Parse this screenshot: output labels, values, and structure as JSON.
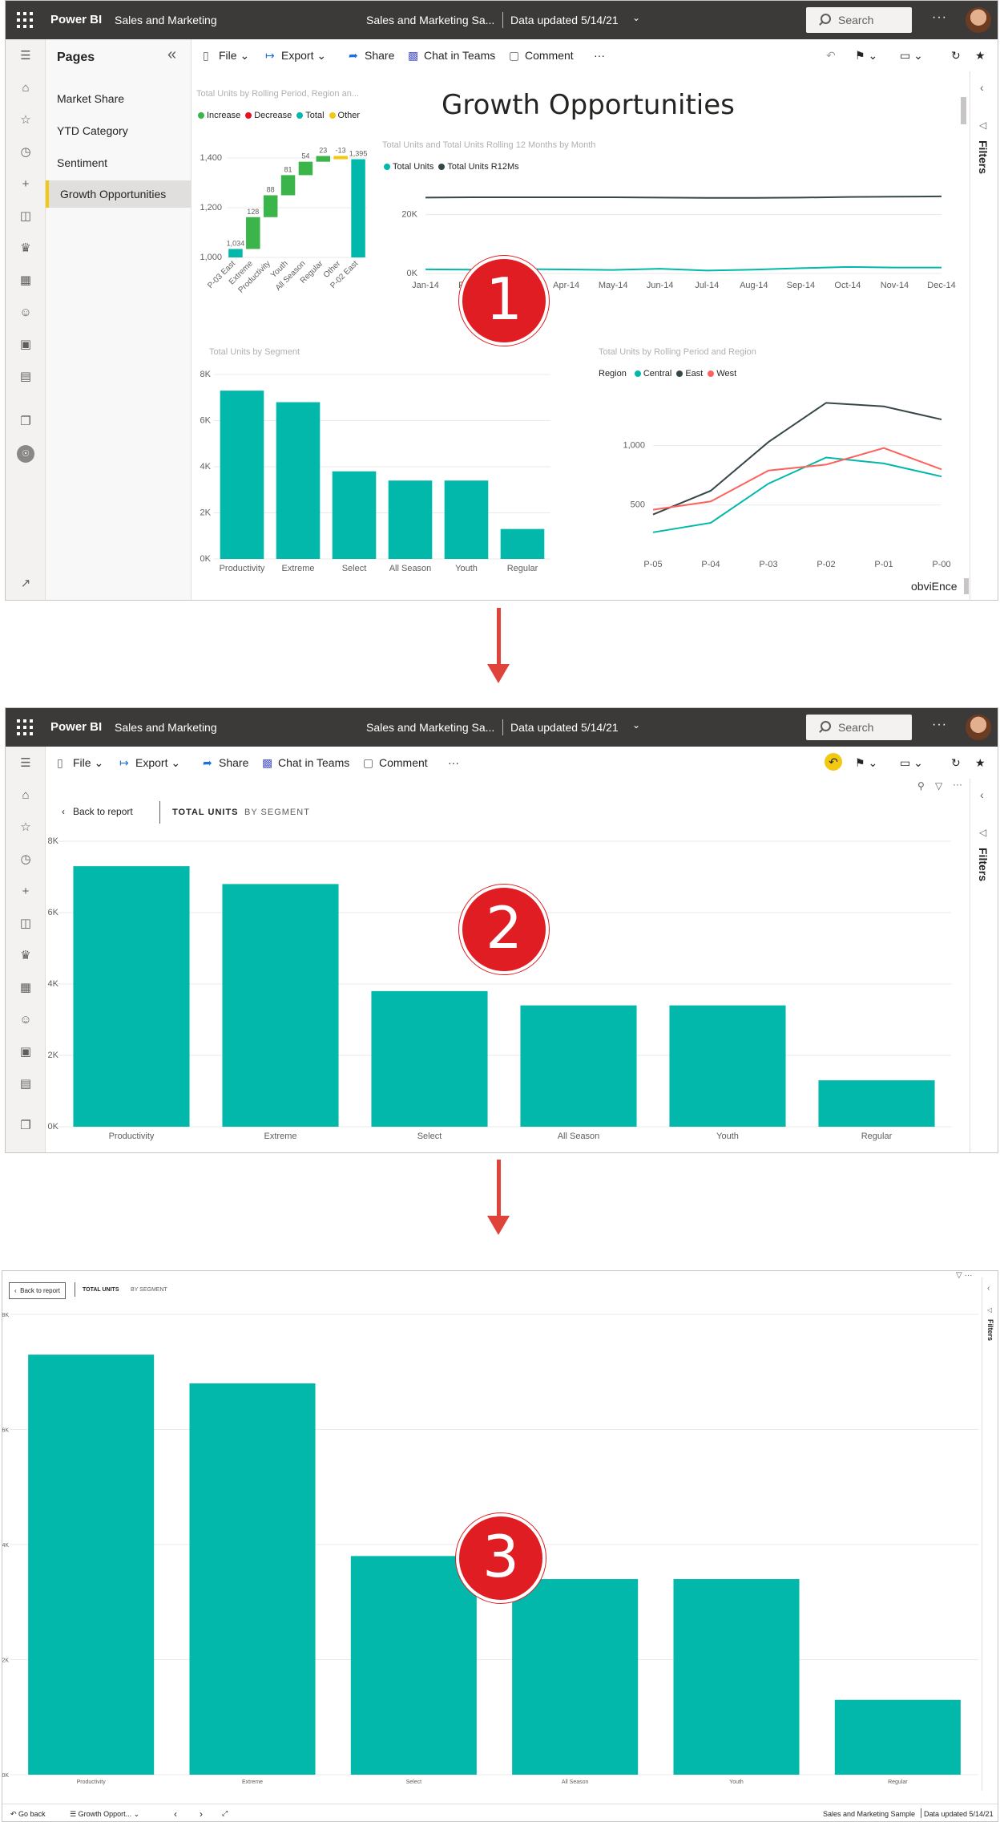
{
  "header": {
    "brand": "Power BI",
    "workspace": "Sales and Marketing",
    "report_title": "Sales and Marketing Sa...",
    "data_updated": "Data updated 5/14/21",
    "search_placeholder": "Search",
    "more": "···"
  },
  "toolbar": {
    "file": "File",
    "export": "Export",
    "share": "Share",
    "chat": "Chat in Teams",
    "comment": "Comment",
    "more": "···"
  },
  "pages_pane": {
    "title": "Pages",
    "items": [
      "Market Share",
      "YTD Category",
      "Sentiment",
      "Growth Opportunities"
    ],
    "selected": "Growth Opportunities"
  },
  "filters_label": "Filters",
  "report": {
    "title": "Growth Opportunities",
    "watermark": "obviEnce",
    "waterfall": {
      "title": "Total Units by Rolling Period, Region an...",
      "legend": [
        "Increase",
        "Decrease",
        "Total",
        "Other"
      ]
    },
    "line12": {
      "title": "Total Units and Total Units Rolling 12 Months by Month",
      "legend": [
        "Total Units",
        "Total Units R12Ms"
      ]
    },
    "segment": {
      "title": "Total Units by Segment"
    },
    "region": {
      "title": "Total Units by Rolling Period and Region",
      "legend_label": "Region",
      "legend": [
        "Central",
        "East",
        "West"
      ]
    }
  },
  "focus": {
    "back": "Back to report",
    "tab_units": "TOTAL UNITS",
    "tab_segment": "BY SEGMENT"
  },
  "fullscreen_footer": {
    "go_back": "Go back",
    "page": "Growth Opport...",
    "report": "Sales and Marketing Sample",
    "updated": "Data updated 5/14/21"
  },
  "steps": [
    "1",
    "2",
    "3"
  ],
  "colors": {
    "teal": "#01b8aa",
    "dark": "#374649",
    "red": "#fd625e",
    "increase": "#3bb44a",
    "decrease": "#e81123",
    "other": "#f2c811",
    "badge": "#e01d22"
  },
  "chart_data": [
    {
      "type": "bar",
      "name": "waterfall",
      "categories": [
        "P-03 East",
        "Extreme",
        "Productivity",
        "Youth",
        "All Season",
        "Regular",
        "Other",
        "P-02 East"
      ],
      "values": [
        1034,
        128,
        88,
        81,
        54,
        23,
        -13,
        1395
      ],
      "labels": [
        "1,034",
        "128",
        "88",
        "81",
        "54",
        "23",
        "-13",
        "1,395"
      ],
      "ylim": [
        1000,
        1400
      ],
      "yticks": [
        "1,000",
        "1,200",
        "1,400"
      ]
    },
    {
      "type": "line",
      "name": "rolling12",
      "categories": [
        "Jan-14",
        "Feb-14",
        "Mar-14",
        "Apr-14",
        "May-14",
        "Jun-14",
        "Jul-14",
        "Aug-14",
        "Sep-14",
        "Oct-14",
        "Nov-14",
        "Dec-14"
      ],
      "series": [
        {
          "name": "Total Units",
          "values": [
            1400,
            1300,
            1500,
            1350,
            1200,
            1600,
            1000,
            1300,
            1800,
            2200,
            2000,
            2000
          ]
        },
        {
          "name": "Total Units R12Ms",
          "values": [
            25800,
            25900,
            25900,
            25900,
            25900,
            25800,
            25700,
            25700,
            25800,
            26000,
            26100,
            26200
          ]
        }
      ],
      "ylim": [
        0,
        30000
      ],
      "yticks": [
        "0K",
        "20K"
      ]
    },
    {
      "type": "bar",
      "name": "segment",
      "categories": [
        "Productivity",
        "Extreme",
        "Select",
        "All Season",
        "Youth",
        "Regular"
      ],
      "values": [
        7300,
        6800,
        3800,
        3400,
        3400,
        1300
      ],
      "ylim": [
        0,
        8000
      ],
      "yticks": [
        "0K",
        "2K",
        "4K",
        "6K",
        "8K"
      ]
    },
    {
      "type": "line",
      "name": "region",
      "categories": [
        "P-05",
        "P-04",
        "P-03",
        "P-02",
        "P-01",
        "P-00"
      ],
      "series": [
        {
          "name": "Central",
          "values": [
            270,
            350,
            680,
            900,
            850,
            740
          ]
        },
        {
          "name": "East",
          "values": [
            420,
            620,
            1030,
            1360,
            1330,
            1220
          ]
        },
        {
          "name": "West",
          "values": [
            460,
            530,
            790,
            840,
            980,
            800
          ]
        }
      ],
      "ylim": [
        100,
        1450
      ],
      "yticks": [
        "500",
        "1,000"
      ]
    }
  ]
}
